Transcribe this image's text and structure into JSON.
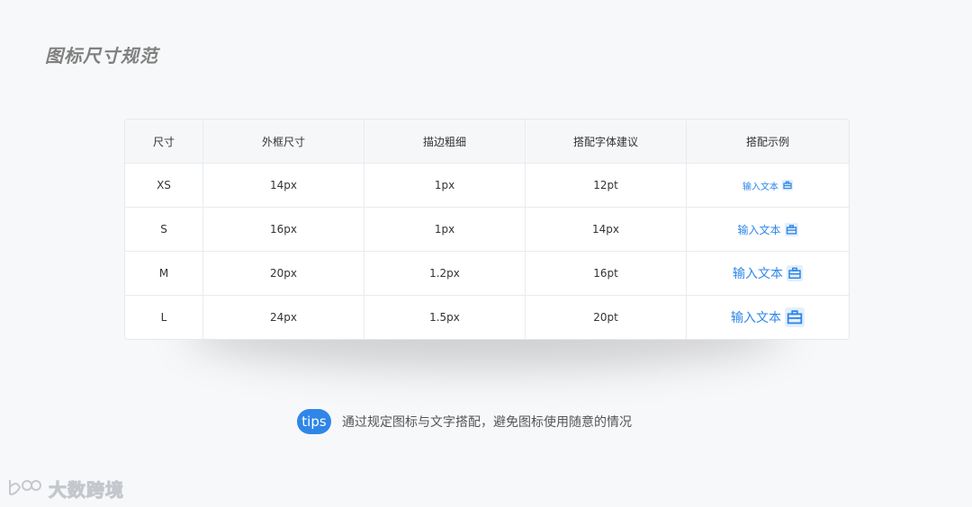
{
  "title": "图标尺寸规范",
  "table": {
    "headers": [
      "尺寸",
      "外框尺寸",
      "描边粗细",
      "搭配字体建议",
      "搭配示例"
    ],
    "rows": [
      {
        "size": "XS",
        "frame": "14px",
        "stroke": "1px",
        "font": "12pt",
        "example_text": "输入文本",
        "example_font_px": 10
      },
      {
        "size": "S",
        "frame": "16px",
        "stroke": "1px",
        "font": "14px",
        "example_text": "输入文本",
        "example_font_px": 12
      },
      {
        "size": "M",
        "frame": "20px",
        "stroke": "1.2px",
        "font": "16pt",
        "example_text": "输入文本",
        "example_font_px": 14
      },
      {
        "size": "L",
        "frame": "24px",
        "stroke": "1.5px",
        "font": "20pt",
        "example_text": "输入文本",
        "example_font_px": 14
      }
    ]
  },
  "tips": {
    "badge": "tips",
    "text": "通过规定图标与文字搭配，避免图标使用随意的情况"
  },
  "watermark": {
    "text": "大数跨境"
  },
  "colors": {
    "accent": "#2f86e8",
    "icon_bg": "#e3effc"
  },
  "icons": {
    "example_icon": "briefcase-icon",
    "logo_icon": "brand-logo-icon"
  }
}
